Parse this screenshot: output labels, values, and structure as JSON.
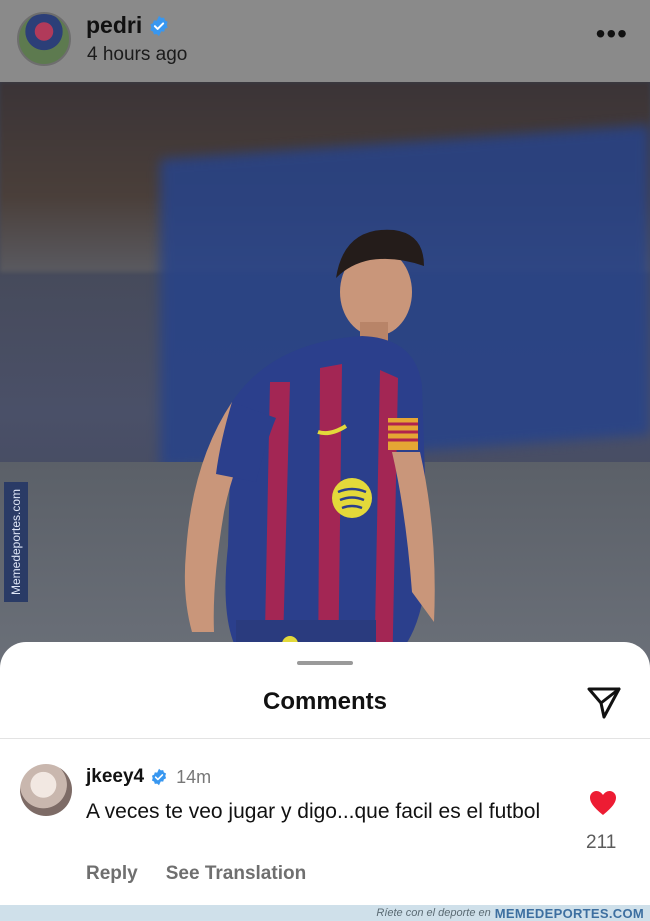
{
  "post": {
    "username": "pedri",
    "time": "4 hours ago",
    "more_icon": "more-horizontal-icon",
    "watermark_side": "Memedeportes.com"
  },
  "comments_sheet": {
    "title": "Comments",
    "share_icon": "send-icon"
  },
  "comment": {
    "username": "jkeey4",
    "time": "14m",
    "text": "A veces te veo jugar y digo...que facil es el futbol",
    "likes": "211",
    "actions": {
      "reply": "Reply",
      "see_translation": "See Translation"
    }
  },
  "footer": {
    "tagline": "Ríete con el deporte en",
    "brand": "MEMEDEPORTES.COM"
  },
  "colors": {
    "verified": "#3897f0",
    "like_red": "#ed1c33",
    "header_bg": "#8a8a8a"
  }
}
